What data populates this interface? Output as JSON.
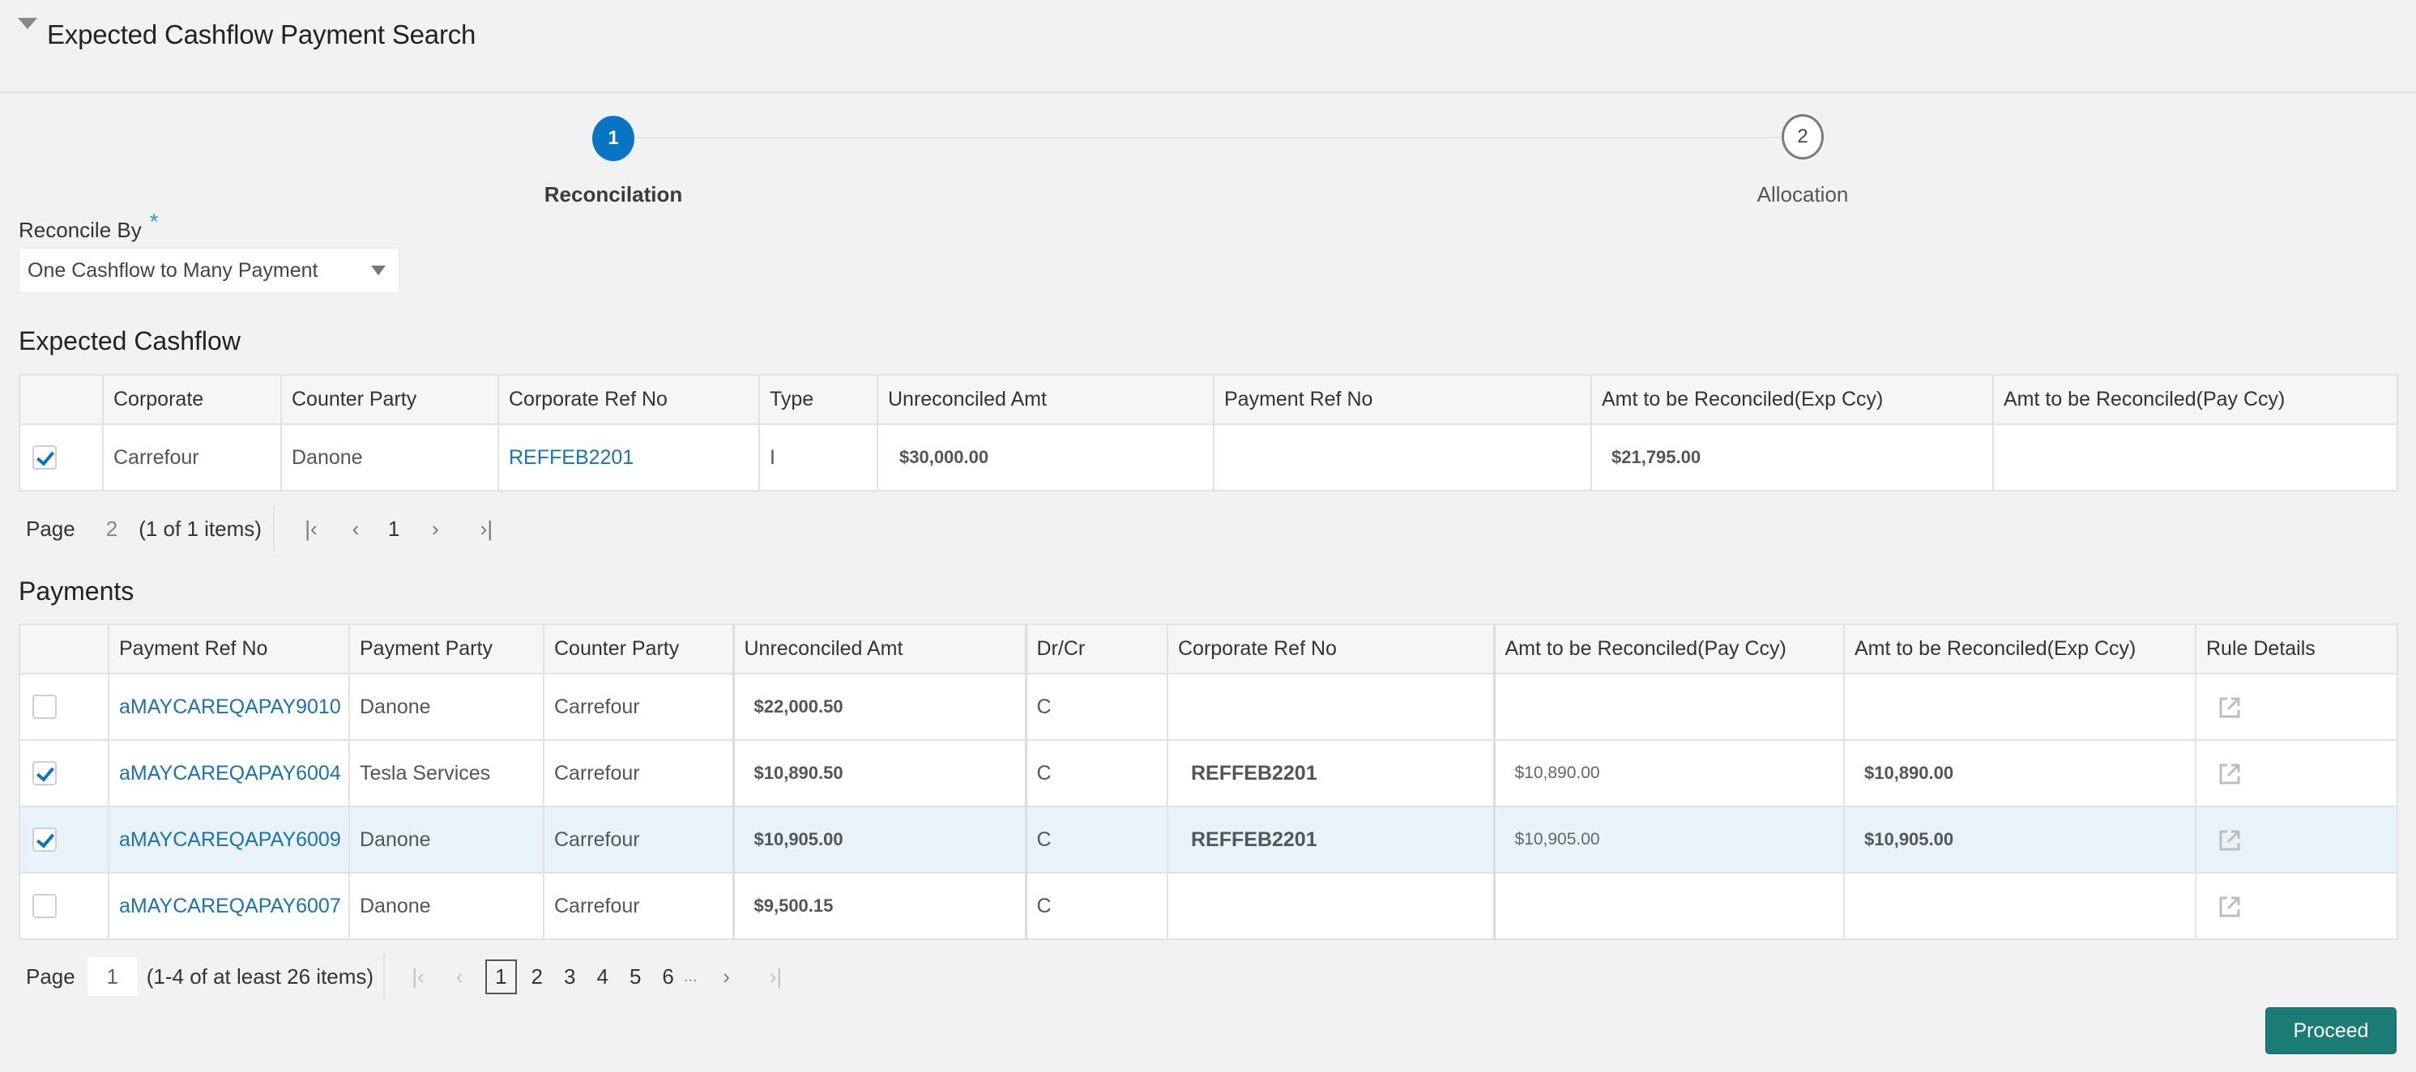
{
  "header": {
    "title": "Expected Cashflow Payment Search",
    "collapse_icon": "triangle-down"
  },
  "stepper": {
    "steps": [
      {
        "number": "1",
        "label": "Reconcilation",
        "state": "active"
      },
      {
        "number": "2",
        "label": "Allocation",
        "state": "inactive"
      }
    ]
  },
  "reconcile_by": {
    "label": "Reconcile By",
    "required_marker": "*",
    "value": "One Cashflow to Many Payment"
  },
  "expected_cashflow": {
    "heading": "Expected Cashflow",
    "columns": [
      "",
      "Corporate",
      "Counter Party",
      "Corporate Ref No",
      "Type",
      "Unreconciled Amt",
      "Payment Ref No",
      "Amt to be Reconciled(Exp Ccy)",
      "Amt to be Reconciled(Pay Ccy)"
    ],
    "rows": [
      {
        "checked": true,
        "corporate": "Carrefour",
        "counter_party": "Danone",
        "corporate_ref_no": "REFFEB2201",
        "type": "I",
        "unreconciled_amt": "$30,000.00",
        "payment_ref_no": "",
        "amt_exp_ccy": "$21,795.00",
        "amt_pay_ccy": ""
      }
    ],
    "pagination": {
      "page_label": "Page",
      "page_value": "2",
      "summary": "(1 of 1 items)",
      "pages": [
        "1"
      ],
      "current_page": "1"
    }
  },
  "payments": {
    "heading": "Payments",
    "columns": [
      "",
      "Payment Ref No",
      "Payment Party",
      "Counter Party",
      "Unreconciled Amt",
      "Dr/Cr",
      "Corporate Ref No",
      "Amt to be Reconciled(Pay Ccy)",
      "Amt to be Reconciled(Exp Ccy)",
      "Rule Details"
    ],
    "rows": [
      {
        "checked": false,
        "highlight": false,
        "payment_ref_no": "aMAYCAREQAPAY9010",
        "payment_party": "Danone",
        "counter_party": "Carrefour",
        "unreconciled_amt": "$22,000.50",
        "dr_cr": "C",
        "corporate_ref_no": "",
        "amt_pay_ccy": "",
        "amt_exp_ccy": ""
      },
      {
        "checked": true,
        "highlight": false,
        "payment_ref_no": "aMAYCAREQAPAY6004",
        "payment_party": "Tesla Services",
        "counter_party": "Carrefour",
        "unreconciled_amt": "$10,890.50",
        "dr_cr": "C",
        "corporate_ref_no": "REFFEB2201",
        "amt_pay_ccy": "$10,890.00",
        "amt_exp_ccy": "$10,890.00"
      },
      {
        "checked": true,
        "highlight": true,
        "payment_ref_no": "aMAYCAREQAPAY6009",
        "payment_party": "Danone",
        "counter_party": "Carrefour",
        "unreconciled_amt": "$10,905.00",
        "dr_cr": "C",
        "corporate_ref_no": "REFFEB2201",
        "amt_pay_ccy": "$10,905.00",
        "amt_exp_ccy": "$10,905.00"
      },
      {
        "checked": false,
        "highlight": false,
        "payment_ref_no": "aMAYCAREQAPAY6007",
        "payment_party": "Danone",
        "counter_party": "Carrefour",
        "unreconciled_amt": "$9,500.15",
        "dr_cr": "C",
        "corporate_ref_no": "",
        "amt_pay_ccy": "",
        "amt_exp_ccy": ""
      }
    ],
    "rule_details_icon": "external-link",
    "pagination": {
      "page_label": "Page",
      "page_value": "1",
      "summary": "(1-4 of at least 26 items)",
      "pages": [
        "1",
        "2",
        "3",
        "4",
        "5",
        "6"
      ],
      "ellipsis": "...",
      "current_page": "1"
    }
  },
  "actions": {
    "proceed_label": "Proceed"
  },
  "colors": {
    "accent_blue": "#0a74c4",
    "link_blue": "#1a72b0",
    "proceed_green": "#1b7c75",
    "row_highlight": "#e8f2fa",
    "required_star": "#1c9fe0"
  }
}
